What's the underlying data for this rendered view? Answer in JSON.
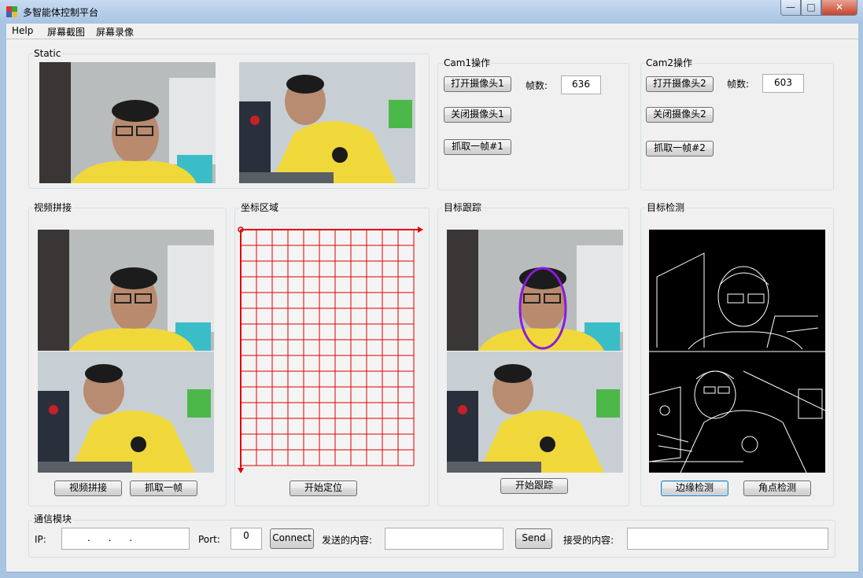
{
  "window": {
    "title": "多智能体控制平台",
    "controls": {
      "minimize": "—",
      "maximize": "□",
      "close": "✕"
    }
  },
  "menu": {
    "items": [
      "Help",
      "屏幕截图",
      "屏幕录像"
    ]
  },
  "static_group": {
    "title": "Static"
  },
  "cam1": {
    "title": "Cam1操作",
    "open_label": "打开摄像头1",
    "close_label": "关闭摄像头1",
    "grab_label": "抓取一帧#1",
    "frames_label": "帧数:",
    "frames_value": "636"
  },
  "cam2": {
    "title": "Cam2操作",
    "open_label": "打开摄像头2",
    "close_label": "关闭摄像头2",
    "grab_label": "抓取一帧#2",
    "frames_label": "帧数:",
    "frames_value": "603"
  },
  "stitch": {
    "title": "视频拼接",
    "stitch_label": "视频拼接",
    "grab_label": "抓取一帧"
  },
  "coord": {
    "title": "坐标区域",
    "locate_label": "开始定位"
  },
  "tracking": {
    "title": "目标跟踪",
    "track_label": "开始跟踪"
  },
  "detection": {
    "title": "目标检测",
    "edge_label": "边缘检测",
    "corner_label": "角点检测"
  },
  "comm": {
    "title": "通信模块",
    "ip_label": "IP:",
    "ip_value": ".      .      .",
    "port_label": "Port:",
    "port_value": "0",
    "connect_label": "Connect",
    "send_content_label": "发送的内容:",
    "send_label": "Send",
    "recv_content_label": "接受的内容:"
  },
  "colors": {
    "grid": "#e00000",
    "tracking_ellipse": "#8a1ae0",
    "shirt": "#f0d83a",
    "focus_border": "#3c7fb1"
  }
}
